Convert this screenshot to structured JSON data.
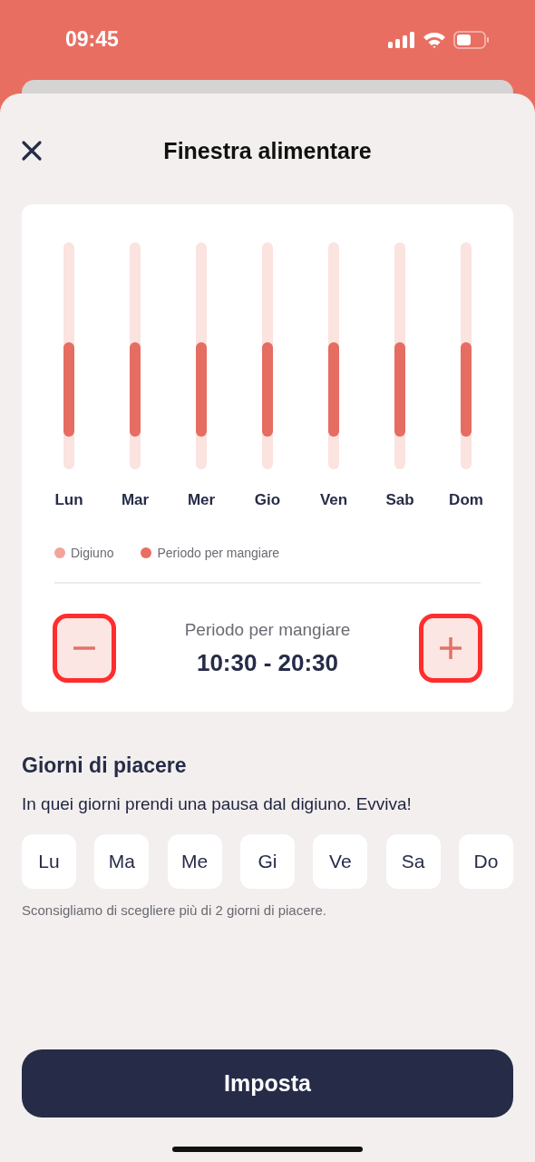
{
  "status_bar": {
    "time": "09:45"
  },
  "header": {
    "title": "Finestra alimentare"
  },
  "schedule": {
    "days": [
      {
        "label": "Lun"
      },
      {
        "label": "Mar"
      },
      {
        "label": "Mer"
      },
      {
        "label": "Gio"
      },
      {
        "label": "Ven"
      },
      {
        "label": "Sab"
      },
      {
        "label": "Dom"
      }
    ],
    "legend": [
      {
        "label": "Digiuno",
        "color": "#f2a59c"
      },
      {
        "label": "Periodo per mangiare",
        "color": "#e96e62"
      }
    ],
    "period_label": "Periodo per mangiare",
    "period_value": "10:30 - 20:30"
  },
  "pleasure_days": {
    "title": "Giorni di piacere",
    "description": "In quei giorni prendi una pausa dal digiuno. Evviva!",
    "days": [
      {
        "label": "Lu",
        "selected": false
      },
      {
        "label": "Ma",
        "selected": false
      },
      {
        "label": "Me",
        "selected": false
      },
      {
        "label": "Gi",
        "selected": false
      },
      {
        "label": "Ve",
        "selected": false
      },
      {
        "label": "Sa",
        "selected": false
      },
      {
        "label": "Do",
        "selected": false
      }
    ],
    "note": "Sconsigliamo di scegliere più di 2 giorni di piacere."
  },
  "primary_button": "Imposta"
}
